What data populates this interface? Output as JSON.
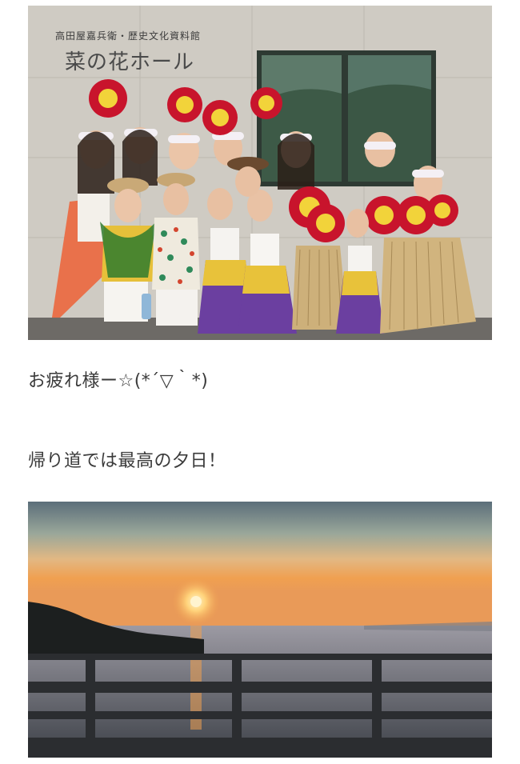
{
  "post": {
    "photo1": {
      "alt": "group photo",
      "sign_small": "高田屋嘉兵衛・歴史文化資料館",
      "sign_large": "菜の花ホール"
    },
    "line1": "お疲れ様ー☆(*´▽｀*)",
    "line2": "帰り道では最高の夕日！",
    "photo2": {
      "alt": "sunset photo"
    }
  },
  "colors": {
    "background": "#ffffff",
    "text": "#3a3a3a",
    "skirt_purple": "#6b3fa0",
    "skirt_yellow": "#e8c23a",
    "flower_red": "#c8142c",
    "sunset_orange": "#f0a050"
  }
}
